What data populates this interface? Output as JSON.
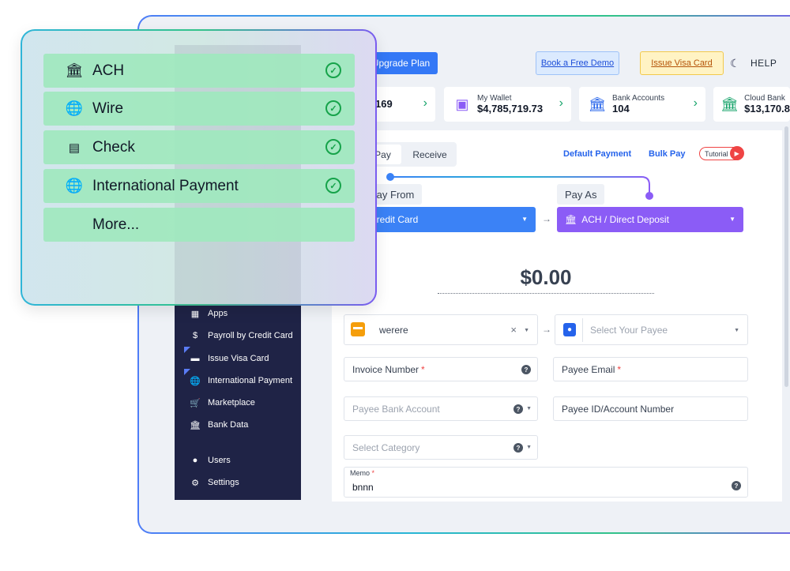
{
  "popup": {
    "items": [
      {
        "label": "ACH",
        "icon": "bank-icon",
        "checked": true
      },
      {
        "label": "Wire",
        "icon": "globe-icon",
        "checked": true
      },
      {
        "label": "Check",
        "icon": "check-icon",
        "checked": true
      },
      {
        "label": "International Payment",
        "icon": "globe-icon",
        "checked": true
      },
      {
        "label": "More...",
        "icon": "",
        "checked": false
      }
    ]
  },
  "topbar": {
    "upgrade_label": "Upgrade Plan",
    "demo_label": "Book a Free Demo",
    "visa_label": "Issue Visa Card",
    "help_label": "HELP"
  },
  "stats": [
    {
      "label": "",
      "value": "169"
    },
    {
      "label": "My Wallet",
      "value": "$4,785,719.73"
    },
    {
      "label": "Bank Accounts",
      "value": "104"
    },
    {
      "label": "Cloud Bank",
      "value": "$13,170.8"
    }
  ],
  "sidebar": {
    "items": [
      {
        "label": "Apps",
        "icon": "apps-icon"
      },
      {
        "label": "Payroll by Credit Card",
        "icon": "dollar-icon"
      },
      {
        "label": "Issue Visa Card",
        "icon": "card-icon"
      },
      {
        "label": "International Payment",
        "icon": "globe-icon"
      },
      {
        "label": "Marketplace",
        "icon": "cart-icon"
      },
      {
        "label": "Bank Data",
        "icon": "bank-icon"
      },
      {
        "label": "Users",
        "icon": "user-icon"
      },
      {
        "label": "Settings",
        "icon": "gear-icon"
      }
    ]
  },
  "payment": {
    "tab_pay": "Pay",
    "tab_receive": "Receive",
    "default_payment": "Default Payment",
    "bulk_pay": "Bulk Pay",
    "tutorial": "Tutorial",
    "pay_from_label": "Pay From",
    "pay_as_label": "Pay As",
    "pay_from_value": "Credit Card",
    "pay_as_value": "ACH / Direct Deposit",
    "amount": "$0.00",
    "payer_value": "werere",
    "payee_placeholder": "Select Your Payee",
    "invoice_label": "Invoice Number",
    "payee_email_label": "Payee Email",
    "payee_bank_placeholder": "Payee Bank Account",
    "payee_id_label": "Payee ID/Account Number",
    "category_placeholder": "Select Category",
    "memo_label": "Memo",
    "memo_value": "bnnn"
  },
  "colors": {
    "sidebar_bg": "#1f2346",
    "primary": "#3b82f6",
    "purple": "#8b5cf6",
    "accent_green": "#16a36a",
    "menu_green": "#9fe8be"
  }
}
